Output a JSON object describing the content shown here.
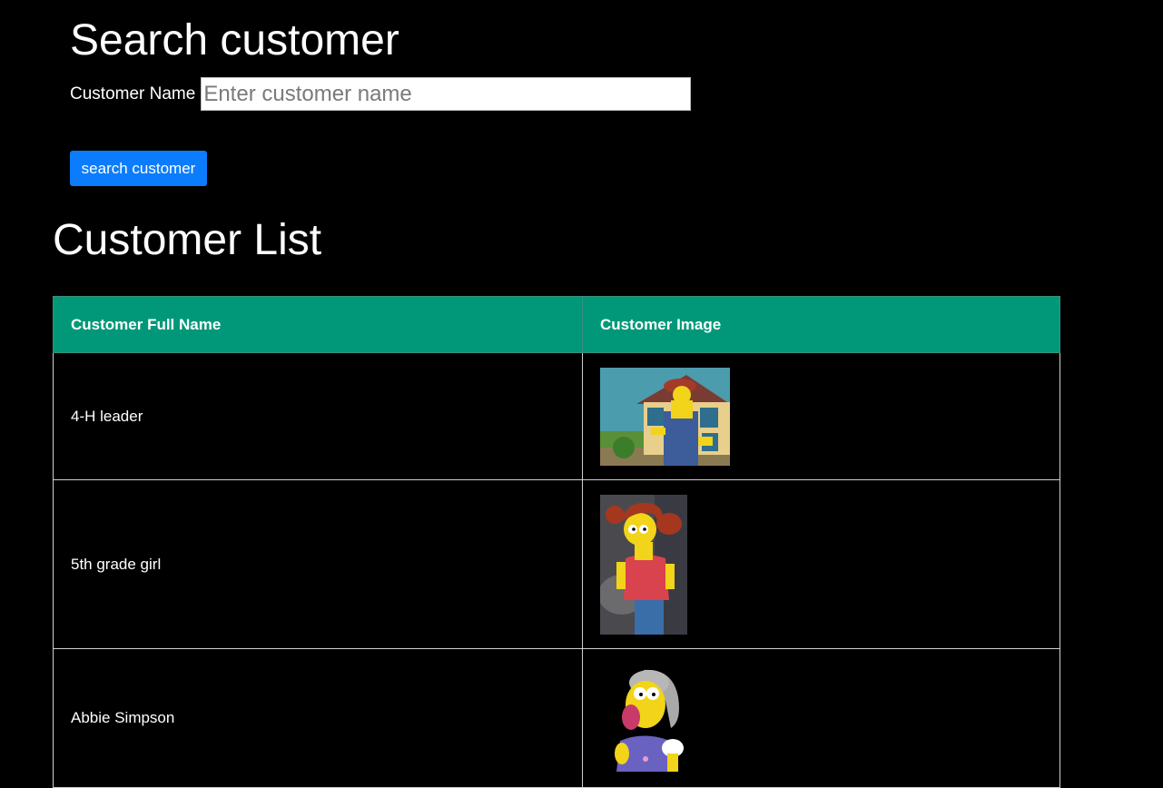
{
  "search": {
    "title": "Search customer",
    "label": "Customer Name",
    "placeholder": "Enter customer name",
    "value": "",
    "button_label": "search customer"
  },
  "list": {
    "title": "Customer List",
    "columns": [
      "Customer Full Name",
      "Customer Image"
    ],
    "rows": [
      {
        "name": "4-H leader"
      },
      {
        "name": "5th grade girl"
      },
      {
        "name": "Abbie Simpson"
      }
    ]
  },
  "colors": {
    "background": "#000000",
    "accent_button": "#0b7dfc",
    "table_header": "#009879",
    "text": "#ffffff"
  }
}
